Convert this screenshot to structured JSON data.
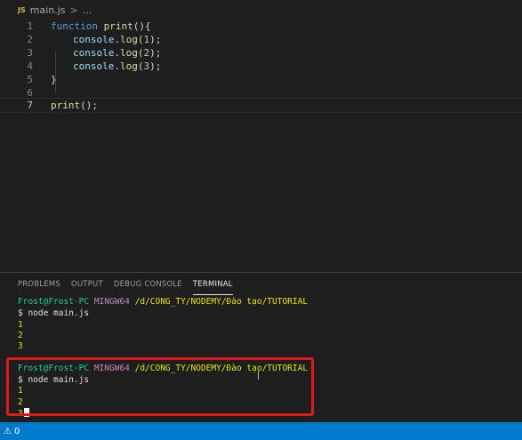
{
  "breadcrumb": {
    "file_badge": "JS",
    "file": "main.js",
    "separator": ">",
    "more": "..."
  },
  "editor": {
    "lines": [
      {
        "number": "1",
        "tokens": [
          "function",
          " ",
          "print",
          "(){"
        ]
      },
      {
        "number": "2",
        "tokens": [
          "console",
          ".",
          "log",
          "(",
          "1",
          ");"
        ]
      },
      {
        "number": "3",
        "tokens": [
          "console",
          ".",
          "log",
          "(",
          "2",
          ");"
        ]
      },
      {
        "number": "4",
        "tokens": [
          "console",
          ".",
          "log",
          "(",
          "3",
          ");"
        ]
      },
      {
        "number": "5",
        "tokens": [
          "}"
        ]
      },
      {
        "number": "6",
        "tokens": []
      },
      {
        "number": "7",
        "tokens": [
          "print",
          "();"
        ]
      }
    ]
  },
  "panel": {
    "tabs": [
      "PROBLEMS",
      "OUTPUT",
      "DEBUG CONSOLE",
      "TERMINAL"
    ],
    "active_tab": "TERMINAL"
  },
  "terminal": {
    "user_host": "Frost@Frost-PC",
    "shell": "MINGW64",
    "path": "/d/CONG_TY/NODEMY/Đào tạo/TUTORIAL",
    "prompt": "$ ",
    "command": "node main.js",
    "outputs": [
      "1",
      "2",
      "3"
    ]
  },
  "statusbar": {
    "warnings": "0"
  },
  "colors": {
    "accent": "#007acc",
    "highlight": "#e01a1a"
  }
}
